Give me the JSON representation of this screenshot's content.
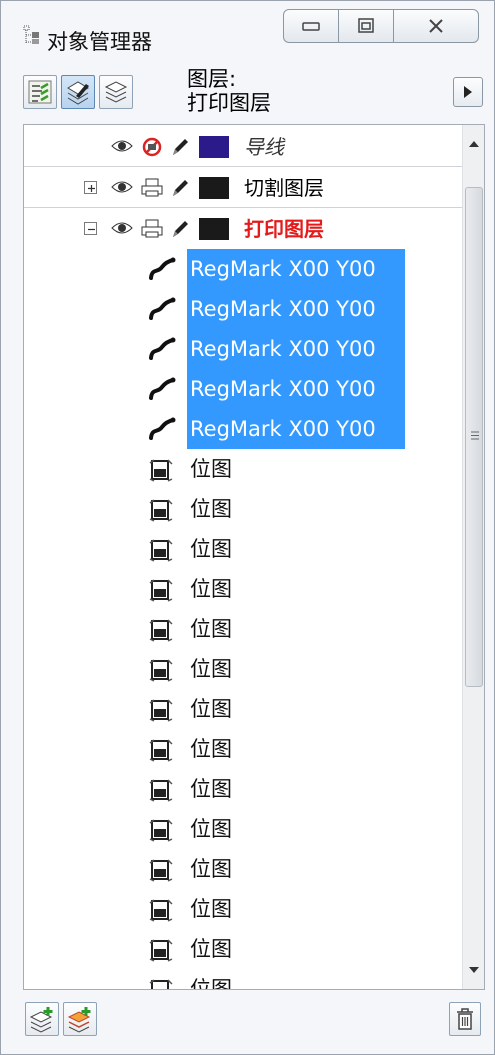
{
  "window": {
    "title": "对象管理器",
    "controls": [
      "minimize",
      "maximize",
      "close"
    ]
  },
  "toolbar": {
    "buttons": [
      {
        "icon": "show-object-properties-icon",
        "active": false
      },
      {
        "icon": "edit-across-layers-icon",
        "active": true
      },
      {
        "icon": "layer-manager-view-icon",
        "active": false
      }
    ],
    "current_layer_caption": "图层:",
    "current_layer_name": "打印图层",
    "menu_arrow_icon": "flyout-arrow-icon"
  },
  "tree": {
    "layers": [
      {
        "name": "导线",
        "style": "italic",
        "color": "#2b1a8a",
        "printable": false,
        "expandable": false
      },
      {
        "name": "切割图层",
        "style": "normal",
        "color": "#1a1a1a",
        "printable": true,
        "expandable": true,
        "expanded": false
      },
      {
        "name": "打印图层",
        "style": "red-bold",
        "color": "#1a1a1a",
        "printable": true,
        "expandable": true,
        "expanded": true
      }
    ],
    "objects": [
      {
        "label": "RegMark X00 Y00",
        "type": "curve",
        "selected": true
      },
      {
        "label": "RegMark X00 Y00",
        "type": "curve",
        "selected": true
      },
      {
        "label": "RegMark X00 Y00",
        "type": "curve",
        "selected": true
      },
      {
        "label": "RegMark X00 Y00",
        "type": "curve",
        "selected": true
      },
      {
        "label": "RegMark X00 Y00",
        "type": "curve",
        "selected": true
      },
      {
        "label": "位图",
        "type": "bitmap",
        "selected": false
      },
      {
        "label": "位图",
        "type": "bitmap",
        "selected": false
      },
      {
        "label": "位图",
        "type": "bitmap",
        "selected": false
      },
      {
        "label": "位图",
        "type": "bitmap",
        "selected": false
      },
      {
        "label": "位图",
        "type": "bitmap",
        "selected": false
      },
      {
        "label": "位图",
        "type": "bitmap",
        "selected": false
      },
      {
        "label": "位图",
        "type": "bitmap",
        "selected": false
      },
      {
        "label": "位图",
        "type": "bitmap",
        "selected": false
      },
      {
        "label": "位图",
        "type": "bitmap",
        "selected": false
      },
      {
        "label": "位图",
        "type": "bitmap",
        "selected": false
      },
      {
        "label": "位图",
        "type": "bitmap",
        "selected": false
      },
      {
        "label": "位图",
        "type": "bitmap",
        "selected": false
      },
      {
        "label": "位图",
        "type": "bitmap",
        "selected": false
      },
      {
        "label": "位图",
        "type": "bitmap",
        "selected": false
      }
    ]
  },
  "bottom": {
    "buttons": [
      {
        "icon": "new-layer-icon"
      },
      {
        "icon": "new-master-layer-icon"
      },
      {
        "icon": "delete-icon"
      }
    ]
  },
  "colors": {
    "selection": "#3399ff",
    "active_layer_text": "#e31b1b"
  }
}
